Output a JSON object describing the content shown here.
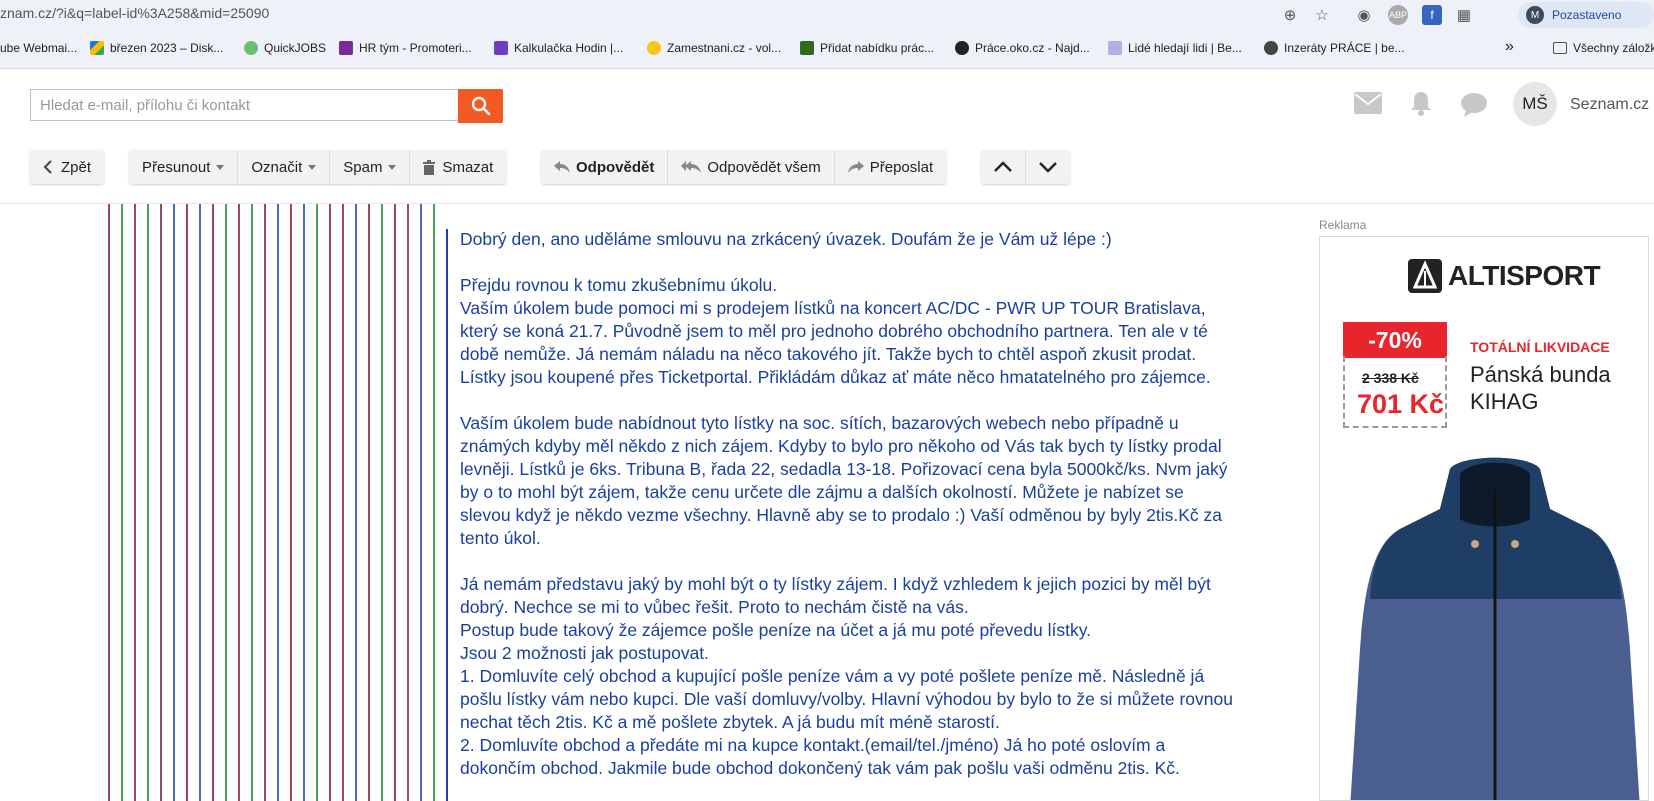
{
  "browser": {
    "url": "znam.cz/?i&q=label-id%3A258&mid=25090",
    "profile_name": "Pozastaveno",
    "profile_initial": "M",
    "bookmarks": [
      {
        "label": "ube Webmai..."
      },
      {
        "label": "březen 2023 – Disk..."
      },
      {
        "label": "QuickJOBS"
      },
      {
        "label": "HR tým - Promoteri..."
      },
      {
        "label": "Kalkulačka Hodin |..."
      },
      {
        "label": "Zamestnani.cz - vol..."
      },
      {
        "label": "Přidat nabídku prác..."
      },
      {
        "label": "Práce.oko.cz - Najd..."
      },
      {
        "label": "Lidé hledají lidi | Be..."
      },
      {
        "label": "Inzeráty PRÁCE | be..."
      }
    ],
    "overflow_glyph": "»",
    "all_bookmarks_label": "Všechny záložk"
  },
  "header": {
    "search_placeholder": "Hledat e-mail, přílohu či kontakt",
    "user_initials": "MŠ",
    "brand": "Seznam.cz"
  },
  "toolbar": {
    "back": "Zpět",
    "move": "Přesunout",
    "mark": "Označit",
    "spam": "Spam",
    "delete": "Smazat",
    "reply": "Odpovědět",
    "reply_all": "Odpovědět všem",
    "forward": "Přeposlat"
  },
  "message": {
    "lines_block1": [
      "Dobrý den, ano uděláme smlouvu na zrkácený úvazek. Doufám že je Vám už lépe :)"
    ],
    "lines_block2": [
      "Přejdu rovnou k tomu zkušebnímu úkolu.",
      "Vaším úkolem bude pomoci mi s prodejem lístků na koncert AC/DC - PWR UP TOUR Bratislava,",
      "který se koná 21.7. Původně jsem to měl pro jednoho dobrého obchodního partnera. Ten ale v té",
      "době nemůže. Já nemám náladu na něco takového jít. Takže bych to chtěl aspoň zkusit prodat.",
      "Lístky jsou koupené přes Ticketportal. Přikládám důkaz ať máte něco hmatatelného pro zájemce."
    ],
    "lines_block3": [
      "Vaším úkolem bude nabídnout tyto lístky na soc. sítích, bazarových webech nebo případně u",
      "známých kdyby měl někdo z nich zájem. Kdyby to bylo pro někoho od Vás tak bych ty lístky prodal",
      "levněji. Lístků je 6ks. Tribuna B, řada 22, sedadla 13-18. Pořizovací cena byla 5000kč/ks. Nvm jaký",
      "by o to mohl být zájem, takže cenu určete dle zájmu a dalších okolností. Můžete je nabízet se",
      "slevou když je někdo vezme všechny. Hlavně aby se to prodalo :) Vaší odměnou by byly 2tis.Kč za",
      "tento úkol."
    ],
    "lines_block4": [
      "Já nemám představu jaký by mohl být o ty lístky zájem. I když vzhledem k jejich pozici by měl být",
      "dobrý. Nechce se mi to vůbec řešit. Proto to nechám čistě na vás.",
      "Postup bude takový že zájemce pošle peníze na účet a já mu poté převedu lístky.",
      "Jsou 2 možnosti jak postupovat.",
      "1. Domluvíte celý obchod a kupující pošle peníze vám a vy poté pošlete peníze mě. Následně já",
      "pošlu lístky vám nebo kupci. Dle vaší domluvy/volby. Hlavní výhodou by bylo to že si můžete rovnou",
      "nechat těch 2tis. Kč a mě pošlete zbytek. A já budu mít méně starostí.",
      "2. Domluvíte obchod a předáte mi na kupce kontakt.(email/tel./jméno) Já ho poté oslovím a",
      "dokončím obchod. Jakmile bude obchod dokončený tak vám pak pošlu vaši odměnu 2tis. Kč."
    ]
  },
  "ad": {
    "label": "Reklama",
    "brand": "ALTISPORT",
    "discount": "-70%",
    "old_price": "2 338 Kč",
    "new_price": "701 Kč",
    "promo": "TOTÁLNÍ LIKVIDACE",
    "product_line1": "Pánská bunda",
    "product_line2": "KIHAG"
  },
  "colors": {
    "accent": "#f15a24",
    "message_text": "#1a3f9e",
    "quote_bar": "#1f3fb0",
    "stripes": [
      "#8b1a3a",
      "#1e8a2e",
      "#1f3fb0"
    ]
  }
}
